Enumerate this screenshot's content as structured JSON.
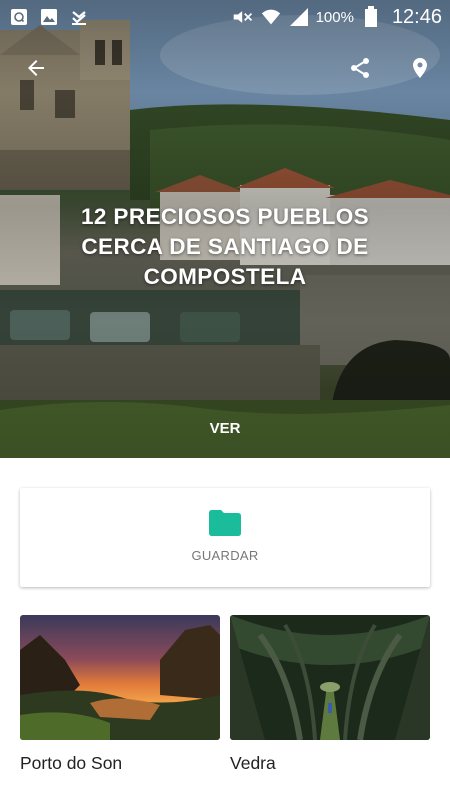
{
  "status_bar": {
    "battery": "100%",
    "time": "12:46",
    "left_icons": [
      "chat-bubble-icon",
      "image-icon",
      "check-download-icon"
    ],
    "right_icons": [
      "mute-icon",
      "wifi-icon",
      "signal-icon",
      "battery-icon"
    ]
  },
  "hero": {
    "title": "12 PRECIOSOS PUEBLOS CERCA DE SANTIAGO DE COMPOSTELA",
    "cta": "VER",
    "actions": [
      "back-arrow-icon",
      "share-icon",
      "location-pin-icon"
    ]
  },
  "save": {
    "label": "GUARDAR",
    "icon": "folder-icon",
    "accent": "#1abc9c"
  },
  "places": [
    {
      "name": "Porto do Son"
    },
    {
      "name": "Vedra"
    }
  ]
}
